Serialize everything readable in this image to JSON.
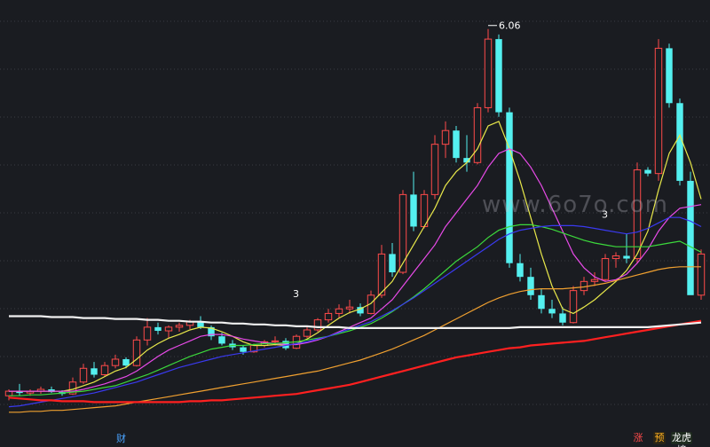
{
  "watermark": "www.6o7o.com",
  "bottom_bar": {
    "finance_marker": "财",
    "badges": [
      "涨",
      "预",
      "龙虎榜"
    ]
  },
  "colors": {
    "background": "#1a1c21",
    "up_candle": "#ff4a4a",
    "down_candle": "#54f0f0",
    "ma_yellow": "#e8e84a",
    "ma_magenta": "#e84ae8",
    "ma_green": "#3cd93c",
    "ma_blue": "#3a3af0",
    "ma_orange": "#f0a030",
    "ma_red": "#ff2020",
    "ma_white": "#f0f0f0"
  },
  "chart_data": {
    "type": "candlestick",
    "ylim": [
      1.8,
      6.3
    ],
    "x_count": 66,
    "candles": [
      [
        2.05,
        2.12,
        2.0,
        2.1
      ],
      [
        2.1,
        2.18,
        2.05,
        2.08
      ],
      [
        2.08,
        2.12,
        2.05,
        2.1
      ],
      [
        2.1,
        2.15,
        2.07,
        2.12
      ],
      [
        2.12,
        2.15,
        2.08,
        2.09
      ],
      [
        2.09,
        2.11,
        2.05,
        2.07
      ],
      [
        2.07,
        2.25,
        2.06,
        2.2
      ],
      [
        2.2,
        2.4,
        2.18,
        2.35
      ],
      [
        2.35,
        2.42,
        2.25,
        2.28
      ],
      [
        2.28,
        2.42,
        2.26,
        2.38
      ],
      [
        2.38,
        2.5,
        2.35,
        2.45
      ],
      [
        2.45,
        2.47,
        2.35,
        2.38
      ],
      [
        2.38,
        2.7,
        2.37,
        2.66
      ],
      [
        2.66,
        2.9,
        2.6,
        2.8
      ],
      [
        2.8,
        2.85,
        2.72,
        2.76
      ],
      [
        2.76,
        2.82,
        2.68,
        2.8
      ],
      [
        2.8,
        2.85,
        2.75,
        2.82
      ],
      [
        2.82,
        2.88,
        2.78,
        2.86
      ],
      [
        2.86,
        2.92,
        2.78,
        2.8
      ],
      [
        2.8,
        2.82,
        2.66,
        2.7
      ],
      [
        2.7,
        2.74,
        2.6,
        2.62
      ],
      [
        2.62,
        2.66,
        2.55,
        2.58
      ],
      [
        2.58,
        2.6,
        2.5,
        2.53
      ],
      [
        2.53,
        2.62,
        2.52,
        2.6
      ],
      [
        2.6,
        2.66,
        2.58,
        2.64
      ],
      [
        2.64,
        2.7,
        2.6,
        2.65
      ],
      [
        2.65,
        2.68,
        2.55,
        2.57
      ],
      [
        2.57,
        2.72,
        2.56,
        2.7
      ],
      [
        2.7,
        2.8,
        2.68,
        2.77
      ],
      [
        2.77,
        2.9,
        2.75,
        2.88
      ],
      [
        2.88,
        3.0,
        2.85,
        2.95
      ],
      [
        2.95,
        3.05,
        2.9,
        3.0
      ],
      [
        3.0,
        3.1,
        2.95,
        3.02
      ],
      [
        3.02,
        3.06,
        2.92,
        2.95
      ],
      [
        2.95,
        3.2,
        2.94,
        3.15
      ],
      [
        3.15,
        3.7,
        3.12,
        3.6
      ],
      [
        3.6,
        3.72,
        3.35,
        3.4
      ],
      [
        3.4,
        4.3,
        3.38,
        4.25
      ],
      [
        4.25,
        4.5,
        3.85,
        3.9
      ],
      [
        3.9,
        4.3,
        3.88,
        4.25
      ],
      [
        4.25,
        4.9,
        4.2,
        4.8
      ],
      [
        4.8,
        5.05,
        4.65,
        4.95
      ],
      [
        4.95,
        5.0,
        4.6,
        4.65
      ],
      [
        4.65,
        4.9,
        4.5,
        4.6
      ],
      [
        4.6,
        5.25,
        4.58,
        5.2
      ],
      [
        5.2,
        6.06,
        5.15,
        5.95
      ],
      [
        5.95,
        6.0,
        5.1,
        5.15
      ],
      [
        5.15,
        5.2,
        3.45,
        3.5
      ],
      [
        3.5,
        3.6,
        3.3,
        3.35
      ],
      [
        3.35,
        3.45,
        3.1,
        3.15
      ],
      [
        3.15,
        3.22,
        2.95,
        3.0
      ],
      [
        3.0,
        3.1,
        2.9,
        2.95
      ],
      [
        2.95,
        3.02,
        2.82,
        2.85
      ],
      [
        2.85,
        3.25,
        2.84,
        3.2
      ],
      [
        3.2,
        3.35,
        3.15,
        3.3
      ],
      [
        3.3,
        3.4,
        3.25,
        3.32
      ],
      [
        3.32,
        3.6,
        3.3,
        3.55
      ],
      [
        3.55,
        3.62,
        3.45,
        3.58
      ],
      [
        3.58,
        3.82,
        3.5,
        3.55
      ],
      [
        3.55,
        4.6,
        3.5,
        4.52
      ],
      [
        4.52,
        4.55,
        4.45,
        4.48
      ],
      [
        4.48,
        5.95,
        4.4,
        5.85
      ],
      [
        5.85,
        5.9,
        5.2,
        5.25
      ],
      [
        5.25,
        5.3,
        4.35,
        4.4
      ],
      [
        4.4,
        4.5,
        3.2,
        3.15
      ],
      [
        3.15,
        3.65,
        3.1,
        3.6
      ]
    ],
    "moving_averages": [
      {
        "color": "#e8e84a",
        "values": [
          2.1,
          2.1,
          2.1,
          2.1,
          2.1,
          2.1,
          2.12,
          2.16,
          2.2,
          2.26,
          2.32,
          2.36,
          2.45,
          2.55,
          2.62,
          2.68,
          2.72,
          2.77,
          2.8,
          2.79,
          2.75,
          2.7,
          2.64,
          2.6,
          2.6,
          2.61,
          2.6,
          2.62,
          2.67,
          2.74,
          2.82,
          2.9,
          2.96,
          3.0,
          3.06,
          3.18,
          3.3,
          3.5,
          3.7,
          3.9,
          4.1,
          4.35,
          4.5,
          4.6,
          4.75,
          5.0,
          5.05,
          4.75,
          4.4,
          4.0,
          3.6,
          3.25,
          3.0,
          2.95,
          3.02,
          3.1,
          3.2,
          3.3,
          3.42,
          3.6,
          3.85,
          4.3,
          4.7,
          4.9,
          4.6,
          4.2
        ]
      },
      {
        "color": "#e84ae8",
        "values": [
          2.1,
          2.1,
          2.1,
          2.1,
          2.1,
          2.1,
          2.1,
          2.12,
          2.15,
          2.18,
          2.22,
          2.26,
          2.32,
          2.4,
          2.48,
          2.55,
          2.6,
          2.65,
          2.7,
          2.72,
          2.72,
          2.7,
          2.67,
          2.65,
          2.63,
          2.62,
          2.61,
          2.61,
          2.63,
          2.66,
          2.7,
          2.75,
          2.8,
          2.85,
          2.9,
          3.0,
          3.1,
          3.25,
          3.4,
          3.55,
          3.7,
          3.9,
          4.05,
          4.2,
          4.35,
          4.55,
          4.7,
          4.75,
          4.7,
          4.55,
          4.35,
          4.1,
          3.85,
          3.6,
          3.45,
          3.35,
          3.3,
          3.32,
          3.38,
          3.5,
          3.65,
          3.85,
          4.0,
          4.1,
          4.12,
          4.14
        ]
      },
      {
        "color": "#3cd93c",
        "values": [
          2.05,
          2.05,
          2.06,
          2.06,
          2.07,
          2.08,
          2.09,
          2.1,
          2.12,
          2.14,
          2.16,
          2.2,
          2.24,
          2.28,
          2.33,
          2.38,
          2.43,
          2.48,
          2.52,
          2.56,
          2.58,
          2.6,
          2.6,
          2.61,
          2.62,
          2.62,
          2.63,
          2.64,
          2.66,
          2.68,
          2.7,
          2.73,
          2.76,
          2.8,
          2.84,
          2.9,
          2.97,
          3.05,
          3.13,
          3.22,
          3.32,
          3.42,
          3.52,
          3.6,
          3.68,
          3.78,
          3.86,
          3.9,
          3.92,
          3.92,
          3.9,
          3.87,
          3.83,
          3.79,
          3.75,
          3.72,
          3.7,
          3.68,
          3.68,
          3.68,
          3.68,
          3.7,
          3.72,
          3.74,
          3.68,
          3.62
        ]
      },
      {
        "color": "#3a3af0",
        "values": [
          1.93,
          1.94,
          1.96,
          1.98,
          2.0,
          2.02,
          2.04,
          2.06,
          2.08,
          2.11,
          2.14,
          2.17,
          2.2,
          2.24,
          2.28,
          2.32,
          2.36,
          2.39,
          2.42,
          2.45,
          2.48,
          2.5,
          2.52,
          2.54,
          2.56,
          2.58,
          2.6,
          2.62,
          2.64,
          2.67,
          2.7,
          2.74,
          2.78,
          2.82,
          2.86,
          2.92,
          2.98,
          3.05,
          3.12,
          3.2,
          3.28,
          3.36,
          3.44,
          3.52,
          3.6,
          3.68,
          3.76,
          3.82,
          3.86,
          3.88,
          3.9,
          3.91,
          3.91,
          3.91,
          3.9,
          3.88,
          3.86,
          3.84,
          3.82,
          3.84,
          3.88,
          3.94,
          4.0,
          4.0,
          3.96,
          3.9
        ]
      },
      {
        "color": "#f0a030",
        "values": [
          1.87,
          1.87,
          1.88,
          1.88,
          1.89,
          1.89,
          1.9,
          1.91,
          1.92,
          1.93,
          1.94,
          1.96,
          1.98,
          2.0,
          2.02,
          2.04,
          2.06,
          2.08,
          2.1,
          2.12,
          2.14,
          2.16,
          2.18,
          2.2,
          2.22,
          2.24,
          2.26,
          2.28,
          2.3,
          2.32,
          2.35,
          2.38,
          2.41,
          2.44,
          2.48,
          2.52,
          2.56,
          2.61,
          2.66,
          2.71,
          2.77,
          2.83,
          2.89,
          2.95,
          3.01,
          3.07,
          3.12,
          3.16,
          3.19,
          3.21,
          3.22,
          3.22,
          3.22,
          3.23,
          3.24,
          3.26,
          3.28,
          3.31,
          3.34,
          3.37,
          3.4,
          3.43,
          3.45,
          3.46,
          3.46,
          3.46
        ]
      },
      {
        "color": "#ff2020",
        "values": [
          2.03,
          2.02,
          2.01,
          2.0,
          2.0,
          1.99,
          1.99,
          1.99,
          1.98,
          1.98,
          1.98,
          1.98,
          1.98,
          1.98,
          1.98,
          1.98,
          1.98,
          1.99,
          1.99,
          2.0,
          2.0,
          2.01,
          2.02,
          2.03,
          2.04,
          2.05,
          2.06,
          2.07,
          2.09,
          2.11,
          2.13,
          2.15,
          2.17,
          2.2,
          2.23,
          2.26,
          2.29,
          2.32,
          2.35,
          2.38,
          2.41,
          2.44,
          2.47,
          2.49,
          2.51,
          2.53,
          2.55,
          2.57,
          2.58,
          2.6,
          2.61,
          2.62,
          2.63,
          2.64,
          2.65,
          2.67,
          2.69,
          2.71,
          2.73,
          2.75,
          2.77,
          2.79,
          2.81,
          2.83,
          2.85,
          2.87
        ]
      },
      {
        "color": "#f0f0f0",
        "values": [
          2.92,
          2.92,
          2.92,
          2.92,
          2.91,
          2.91,
          2.91,
          2.9,
          2.9,
          2.9,
          2.89,
          2.89,
          2.89,
          2.88,
          2.88,
          2.87,
          2.87,
          2.86,
          2.86,
          2.85,
          2.85,
          2.84,
          2.84,
          2.83,
          2.83,
          2.82,
          2.82,
          2.81,
          2.81,
          2.8,
          2.8,
          2.8,
          2.79,
          2.79,
          2.79,
          2.79,
          2.79,
          2.79,
          2.79,
          2.79,
          2.79,
          2.79,
          2.79,
          2.79,
          2.79,
          2.79,
          2.79,
          2.79,
          2.8,
          2.8,
          2.8,
          2.8,
          2.8,
          2.8,
          2.8,
          2.8,
          2.8,
          2.8,
          2.8,
          2.8,
          2.8,
          2.81,
          2.82,
          2.83,
          2.84,
          2.85
        ]
      }
    ],
    "annotations": [
      {
        "text": "6.06",
        "candle": 45,
        "price": 6.06
      },
      {
        "text": "3",
        "candle": 27,
        "price": 3.05
      },
      {
        "text": "3",
        "candle": 56,
        "price": 3.92
      }
    ]
  }
}
